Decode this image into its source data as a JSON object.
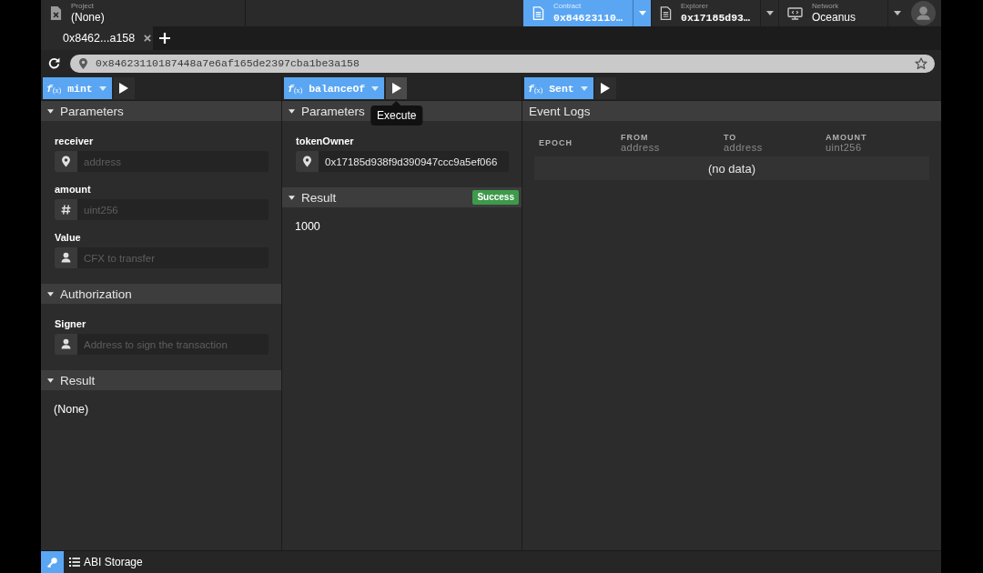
{
  "top_bar": {
    "project": {
      "label": "Project",
      "value": "(None)"
    },
    "selectors": [
      {
        "kind": "contract",
        "label": "Contract",
        "value": "0x84623110…",
        "selected": true
      },
      {
        "kind": "explorer",
        "label": "Explorer",
        "value": "0x17185d93…",
        "selected": false
      },
      {
        "kind": "network",
        "label": "Network",
        "value": "Oceanus",
        "selected": false
      }
    ]
  },
  "tabs": [
    {
      "label": "0x8462...a158",
      "selected": true
    }
  ],
  "address_bar": {
    "value": "0x84623110187448a7e6af165de2397cba1be3a158"
  },
  "panels": [
    {
      "function": "*f*$_{(x)}$ mint",
      "execute": {
        "hovered": false
      },
      "sections": [
        {
          "kind": "form",
          "title": "Parameters",
          "expanded": true,
          "fields": [
            {
              "kind": "address",
              "label": "receiver",
              "placeholder": "address"
            },
            {
              "kind": "uint256",
              "label": "amount",
              "placeholder": "uint256"
            },
            {
              "kind": "payable",
              "label": "Value",
              "placeholder": "CFX to transfer"
            }
          ]
        },
        {
          "kind": "form",
          "title": "Authorization",
          "expanded": true,
          "fields": [
            {
              "kind": "signer",
              "label": "Signer",
              "placeholder": "Address to sign the transaction"
            }
          ]
        },
        {
          "kind": "result",
          "title": "Result",
          "expanded": true,
          "value": "(None)"
        }
      ]
    },
    {
      "function": "*f*$_{(x)}$ balanceOf",
      "execute": {
        "hovered": true,
        "tooltip": "Execute"
      },
      "sections": [
        {
          "kind": "form",
          "title": "Parameters",
          "expanded": true,
          "fields": [
            {
              "kind": "address",
              "label": "tokenOwner",
              "value": "0x17185d938f9d390947ccc9a5ef066"
            }
          ]
        },
        {
          "kind": "result",
          "title": "Result",
          "expanded": true,
          "status": {
            "kind": "success",
            "text": "Success"
          },
          "value": "1000"
        }
      ]
    },
    {
      "function": "*f*$_{(x)}$ Sent",
      "execute": {
        "hovered": false
      },
      "sections": [
        {
          "kind": "events",
          "title": "Event Logs",
          "columns": [
            {
              "name": "EPOCH"
            },
            {
              "name": "FROM",
              "type": "address"
            },
            {
              "name": "TO",
              "type": "address"
            },
            {
              "name": "AMOUNT",
              "type": "uint256"
            }
          ],
          "empty_text": "(no data)"
        }
      ]
    }
  ],
  "bottom_bar": {
    "label": "ABI Storage"
  }
}
